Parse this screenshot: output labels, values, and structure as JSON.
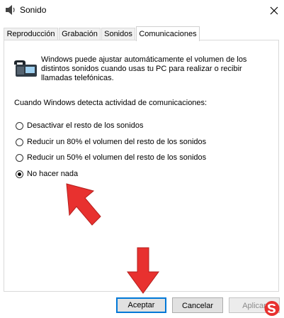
{
  "window": {
    "title": "Sonido"
  },
  "tabs": [
    {
      "label": "Reproducción"
    },
    {
      "label": "Grabación"
    },
    {
      "label": "Sonidos"
    },
    {
      "label": "Comunicaciones"
    }
  ],
  "panel": {
    "description": "Windows puede ajustar automáticamente el volumen de los distintos sonidos cuando usas tu PC para realizar o recibir llamadas telefónicas.",
    "heading": "Cuando Windows detecta actividad de comunicaciones:",
    "options": [
      {
        "label": "Desactivar el resto de los sonidos",
        "checked": false
      },
      {
        "label": "Reducir un 80% el volumen del resto de los sonidos",
        "checked": false
      },
      {
        "label": "Reducir un 50% el volumen del resto de los sonidos",
        "checked": false
      },
      {
        "label": "No hacer nada",
        "checked": true
      }
    ]
  },
  "buttons": {
    "accept": "Aceptar",
    "cancel": "Cancelar",
    "apply": "Aplicar"
  },
  "colors": {
    "arrow": "#e8312f",
    "default_button_border": "#0078d7",
    "logo": "#e8312f"
  }
}
